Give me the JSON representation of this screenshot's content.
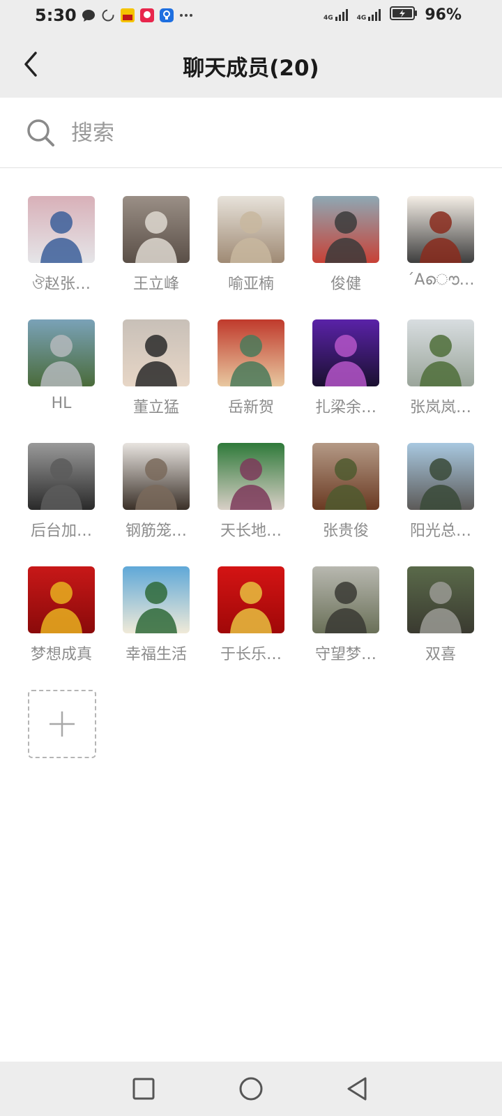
{
  "status_bar": {
    "time": "5:30",
    "network_1": "4G",
    "network_2": "4G",
    "battery": "96%"
  },
  "header": {
    "title": "聊天成员(20)"
  },
  "search": {
    "placeholder": "搜索",
    "value": ""
  },
  "members": [
    {
      "name": "ঔ赵张…",
      "colors": [
        "#d8b0b8",
        "#3c5f9a",
        "#e5e5e8"
      ]
    },
    {
      "name": "王立峰",
      "colors": [
        "#9a8f86",
        "#ded8d0",
        "#5a4f47"
      ]
    },
    {
      "name": "喻亚楠",
      "colors": [
        "#e7e2da",
        "#c8b79f",
        "#9f8a74"
      ]
    },
    {
      "name": "俊健",
      "colors": [
        "#8ea8b4",
        "#3b3b3b",
        "#c84136"
      ]
    },
    {
      "name": "ˊAൌ…",
      "colors": [
        "#f4eee6",
        "#8a2b1d",
        "#3e3e3e"
      ]
    },
    {
      "name": "HL",
      "colors": [
        "#7aa2b8",
        "#b4b8bc",
        "#4a6b3a"
      ]
    },
    {
      "name": "董立猛",
      "colors": [
        "#c8c0b8",
        "#2a2a2a",
        "#e7d6c6"
      ]
    },
    {
      "name": "岳新贺",
      "colors": [
        "#c03a2c",
        "#4a7a5a",
        "#e8c8a0"
      ]
    },
    {
      "name": "扎梁余…",
      "colors": [
        "#5a22a8",
        "#b455c8",
        "#1a1030"
      ]
    },
    {
      "name": "张岚岚…",
      "colors": [
        "#d8dde0",
        "#4f6f3a",
        "#9aa59a"
      ]
    },
    {
      "name": "后台加…",
      "colors": [
        "#9a9a9a",
        "#5c5c5c",
        "#2a2a2a"
      ]
    },
    {
      "name": "钢筋笼…",
      "colors": [
        "#e8e4e0",
        "#7a6a5c",
        "#3a3028"
      ]
    },
    {
      "name": "天长地…",
      "colors": [
        "#2f7a3a",
        "#7c3a5a",
        "#d8cfc6"
      ]
    },
    {
      "name": "张贵俊",
      "colors": [
        "#b49a86",
        "#4f5a2f",
        "#6a3a22"
      ]
    },
    {
      "name": "阳光总…",
      "colors": [
        "#a8c8e0",
        "#3a4a38",
        "#5c5a58"
      ]
    },
    {
      "name": "梦想成真",
      "colors": [
        "#c81818",
        "#e8b020",
        "#8a0a0a"
      ]
    },
    {
      "name": "幸福生活",
      "colors": [
        "#5fa8d8",
        "#2f6a3a",
        "#f0ead8"
      ]
    },
    {
      "name": "于长乐…",
      "colors": [
        "#d41414",
        "#e8c040",
        "#a00808"
      ]
    },
    {
      "name": "守望梦…",
      "colors": [
        "#b8b8b0",
        "#3a3a34",
        "#6a7058"
      ]
    },
    {
      "name": "双喜",
      "colors": [
        "#5a6a4a",
        "#9a9a94",
        "#3a3a30"
      ]
    }
  ],
  "add_member": {
    "icon": "plus-icon"
  },
  "nav": {
    "recents": "square-icon",
    "home": "circle-icon",
    "back": "triangle-back-icon"
  }
}
